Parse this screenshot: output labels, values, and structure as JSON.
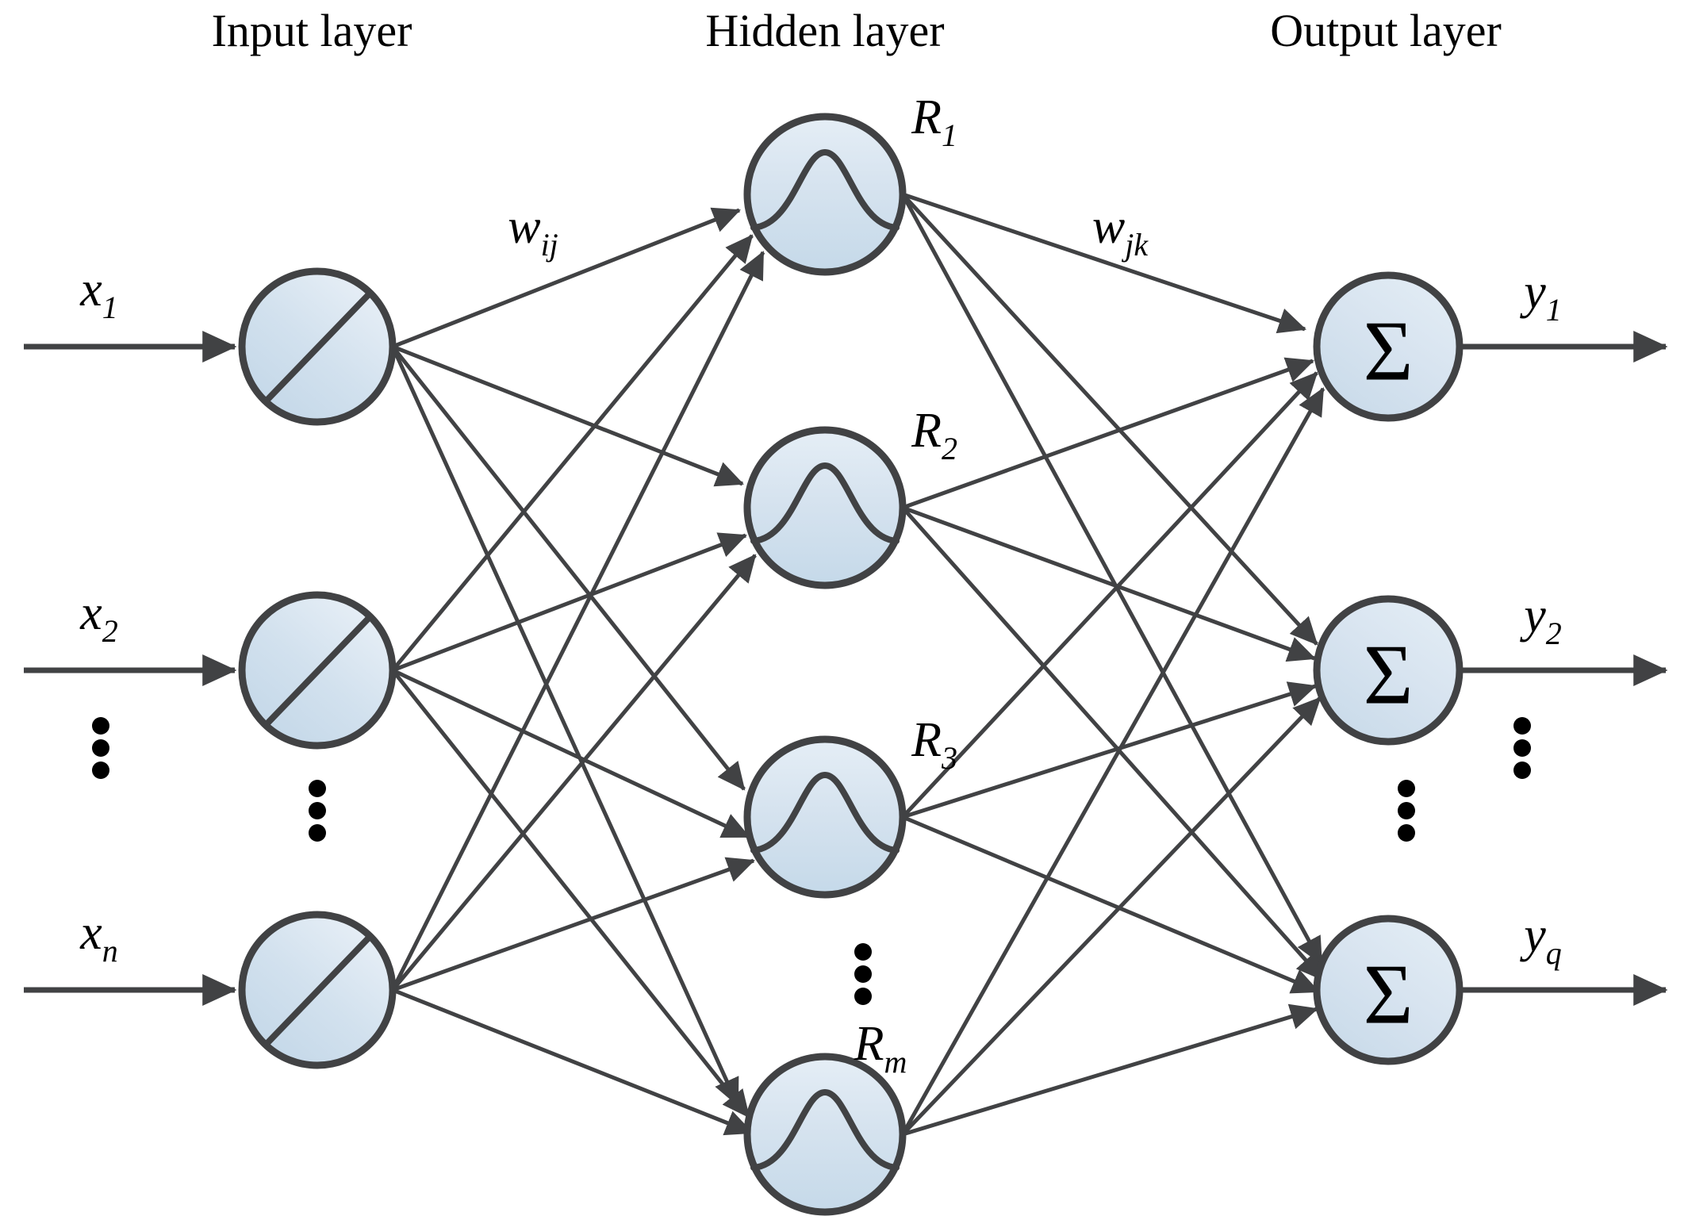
{
  "figure": {
    "kind": "rbf-neural-network-architecture-diagram",
    "background_color": "#ffffff"
  },
  "colors": {
    "stroke": "#414244",
    "node_fill_light": "#e6eef5",
    "node_fill_dark": "#c4d8e9",
    "text": "#000000"
  },
  "titles": {
    "input": "Input layer",
    "hidden": "Hidden layer",
    "output": "Output layer"
  },
  "weights": {
    "input_to_hidden": {
      "base": "w",
      "sub": "ij"
    },
    "hidden_to_output": {
      "base": "w",
      "sub": "jk"
    }
  },
  "input_layer": {
    "node_symbol": "linear-ramp",
    "nodes": [
      {
        "base": "x",
        "sub": "1"
      },
      {
        "base": "x",
        "sub": "2"
      },
      {
        "base": "x",
        "sub": "n"
      }
    ],
    "ellipsis": "vertical-dots"
  },
  "hidden_layer": {
    "node_symbol": "gaussian-bell-curve",
    "nodes": [
      {
        "base": "R",
        "sub": "1"
      },
      {
        "base": "R",
        "sub": "2"
      },
      {
        "base": "R",
        "sub": "3"
      },
      {
        "base": "R",
        "sub": "m"
      }
    ],
    "ellipsis": "vertical-dots"
  },
  "output_layer": {
    "node_symbol": "Σ",
    "nodes": [
      {
        "base": "y",
        "sub": "1"
      },
      {
        "base": "y",
        "sub": "2"
      },
      {
        "base": "y",
        "sub": "q"
      }
    ],
    "ellipsis": "vertical-dots"
  },
  "chart_data": {
    "type": "diagram",
    "title": "Radial Basis Function (RBF) neural network topology",
    "layers": [
      {
        "name": "Input layer",
        "node_count_shown": 3,
        "node_labels": [
          "x1",
          "x2",
          "xn"
        ],
        "node_glyph": "diagonal line (identity / linear)",
        "truncated": true
      },
      {
        "name": "Hidden layer",
        "node_count_shown": 4,
        "node_labels": [
          "R1",
          "R2",
          "R3",
          "Rm"
        ],
        "node_glyph": "bell curve (radial basis function)",
        "truncated": true
      },
      {
        "name": "Output layer",
        "node_count_shown": 3,
        "node_labels": [
          "y1",
          "y2",
          "yq"
        ],
        "node_glyph": "sigma (summation)",
        "truncated": true
      }
    ],
    "connections": [
      {
        "from": "Input layer",
        "to": "Hidden layer",
        "pattern": "fully-connected",
        "weight_label": "wij"
      },
      {
        "from": "Hidden layer",
        "to": "Output layer",
        "pattern": "fully-connected",
        "weight_label": "wjk"
      }
    ]
  }
}
